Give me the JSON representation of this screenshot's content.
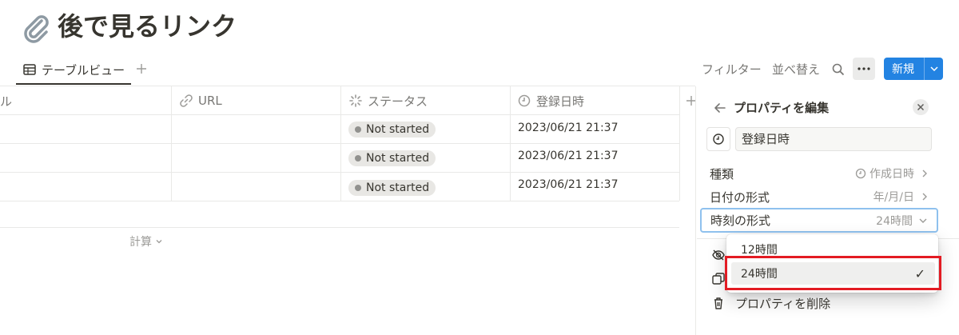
{
  "page": {
    "title": "後で見るリンク",
    "title_icon": "paperclip-icon"
  },
  "views": {
    "active_tab": "テーブルビュー",
    "tab_icon": "table-icon",
    "add_icon": "plus-icon"
  },
  "toolbar": {
    "filter_label": "フィルター",
    "sort_label": "並べ替え",
    "search_icon": "search-icon",
    "more_icon": "more-horizontal-icon",
    "new_label": "新規",
    "accent_color": "#2383e2"
  },
  "table": {
    "columns": [
      {
        "label": "ル",
        "icon": ""
      },
      {
        "label": "URL",
        "icon": "link-icon"
      },
      {
        "label": "ステータス",
        "icon": "status-icon"
      },
      {
        "label": "登録日時",
        "icon": "clock-icon"
      }
    ],
    "rows": [
      {
        "status": "Not started",
        "created": "2023/06/21 21:37"
      },
      {
        "status": "Not started",
        "created": "2023/06/21 21:37"
      },
      {
        "status": "Not started",
        "created": "2023/06/21 21:37"
      }
    ],
    "calc_label": "計算"
  },
  "panel": {
    "title": "プロパティを編集",
    "property_name": "登録日時",
    "type_label": "種類",
    "type_value": "作成日時",
    "date_format_label": "日付の形式",
    "date_format_value": "年/月/日",
    "time_format_label": "時刻の形式",
    "time_format_value": "24時間",
    "delete_label": "プロパティを削除"
  },
  "dropdown": {
    "options": [
      {
        "label": "12時間",
        "selected": false
      },
      {
        "label": "24時間",
        "selected": true
      }
    ],
    "checkmark": "✓",
    "highlight_color": "#e31b23"
  }
}
